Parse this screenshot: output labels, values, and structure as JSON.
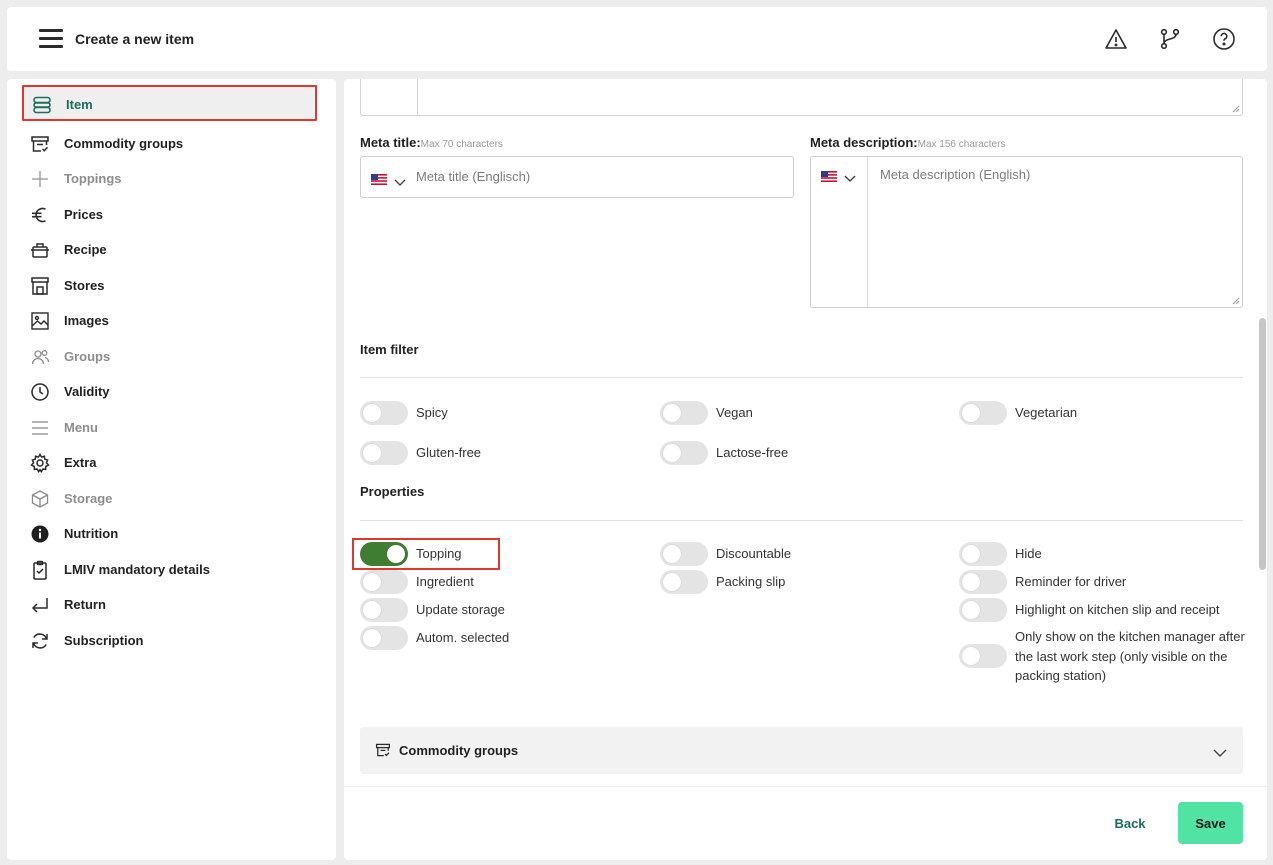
{
  "header": {
    "title": "Create a new item",
    "icons": [
      "menu-icon",
      "warning-icon",
      "branch-icon",
      "help-icon"
    ]
  },
  "sidebar": {
    "items": [
      {
        "label": "Item",
        "icon": "layers-icon",
        "active": true,
        "muted": false
      },
      {
        "label": "Commodity groups",
        "icon": "archive-icon",
        "active": false,
        "muted": false
      },
      {
        "label": "Toppings",
        "icon": "plus-icon",
        "active": false,
        "muted": true
      },
      {
        "label": "Prices",
        "icon": "euro-icon",
        "active": false,
        "muted": false
      },
      {
        "label": "Recipe",
        "icon": "pot-icon",
        "active": false,
        "muted": false
      },
      {
        "label": "Stores",
        "icon": "store-icon",
        "active": false,
        "muted": false
      },
      {
        "label": "Images",
        "icon": "image-icon",
        "active": false,
        "muted": false
      },
      {
        "label": "Groups",
        "icon": "users-icon",
        "active": false,
        "muted": true
      },
      {
        "label": "Validity",
        "icon": "clock-icon",
        "active": false,
        "muted": false
      },
      {
        "label": "Menu",
        "icon": "menu-lines-icon",
        "active": false,
        "muted": true
      },
      {
        "label": "Extra",
        "icon": "gear-icon",
        "active": false,
        "muted": false
      },
      {
        "label": "Storage",
        "icon": "box-icon",
        "active": false,
        "muted": true
      },
      {
        "label": "Nutrition",
        "icon": "info-icon",
        "active": false,
        "muted": false
      },
      {
        "label": "LMIV mandatory details",
        "icon": "clipboard-check-icon",
        "active": false,
        "muted": false
      },
      {
        "label": "Return",
        "icon": "return-icon",
        "active": false,
        "muted": false
      },
      {
        "label": "Subscription",
        "icon": "refresh-icon",
        "active": false,
        "muted": false
      }
    ]
  },
  "meta": {
    "title_label": "Meta title:",
    "title_hint": "Max 70 characters",
    "title_placeholder": "Meta title (Englisch)",
    "desc_label": "Meta description:",
    "desc_hint": "Max 156 characters",
    "desc_placeholder": "Meta description (English)",
    "language_flag": "us-flag-icon"
  },
  "item_filter": {
    "title": "Item filter",
    "toggles": [
      {
        "label": "Spicy",
        "on": false
      },
      {
        "label": "Vegan",
        "on": false
      },
      {
        "label": "Vegetarian",
        "on": false
      },
      {
        "label": "Gluten-free",
        "on": false
      },
      {
        "label": "Lactose-free",
        "on": false
      }
    ]
  },
  "properties": {
    "title": "Properties",
    "toggles": [
      {
        "label": "Topping",
        "on": true
      },
      {
        "label": "Ingredient",
        "on": false
      },
      {
        "label": "Update storage",
        "on": false
      },
      {
        "label": "Autom. selected",
        "on": false
      },
      {
        "label": "Discountable",
        "on": false
      },
      {
        "label": "Packing slip",
        "on": false
      },
      {
        "label": "Hide",
        "on": false
      },
      {
        "label": "Reminder for driver",
        "on": false
      },
      {
        "label": "Highlight on kitchen slip and receipt",
        "on": false
      },
      {
        "label": "Only show on the kitchen manager after the last work step (only visible on the packing station)",
        "on": false
      }
    ]
  },
  "accordion": {
    "label": "Commodity groups"
  },
  "footer": {
    "back_label": "Back",
    "save_label": "Save"
  },
  "colors": {
    "accent": "#1b6e5c",
    "toggle_on": "#3e7d32",
    "save_button": "#50e3a4",
    "highlight": "#e2382c"
  }
}
